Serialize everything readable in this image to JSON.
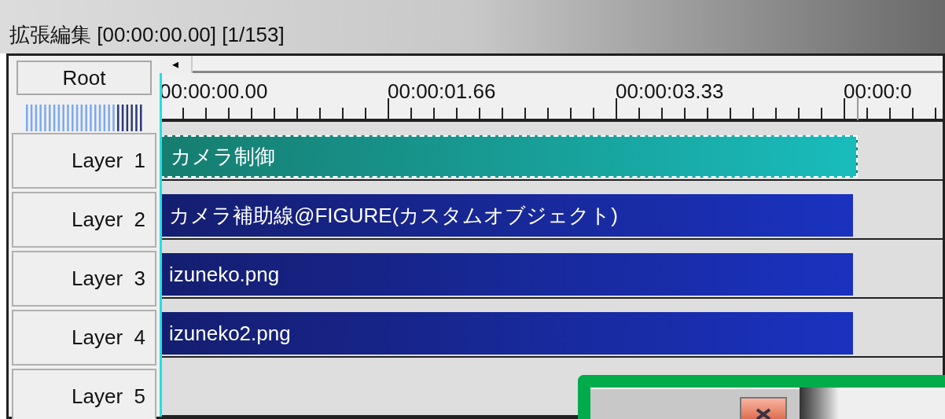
{
  "window": {
    "title": "拡張編集 [00:00:00.00] [1/153]"
  },
  "root_button": "Root",
  "scroll_left": "◂",
  "ruler": {
    "labels": [
      "00:00:00.00",
      "00:00:01.66",
      "00:00:03.33",
      "00:00:0"
    ]
  },
  "layers": [
    {
      "label": "Layer  1",
      "clip": {
        "kind": "camera",
        "text": "カメラ制御",
        "selected": true
      }
    },
    {
      "label": "Layer  2",
      "clip": {
        "kind": "media",
        "text": "カメラ補助線@FIGURE(カスタムオブジェクト)",
        "selected": false
      }
    },
    {
      "label": "Layer  3",
      "clip": {
        "kind": "media",
        "text": "izuneko.png",
        "selected": false
      }
    },
    {
      "label": "Layer  4",
      "clip": {
        "kind": "media",
        "text": "izuneko2.png",
        "selected": false
      }
    },
    {
      "label": "Layer  5"
    }
  ]
}
